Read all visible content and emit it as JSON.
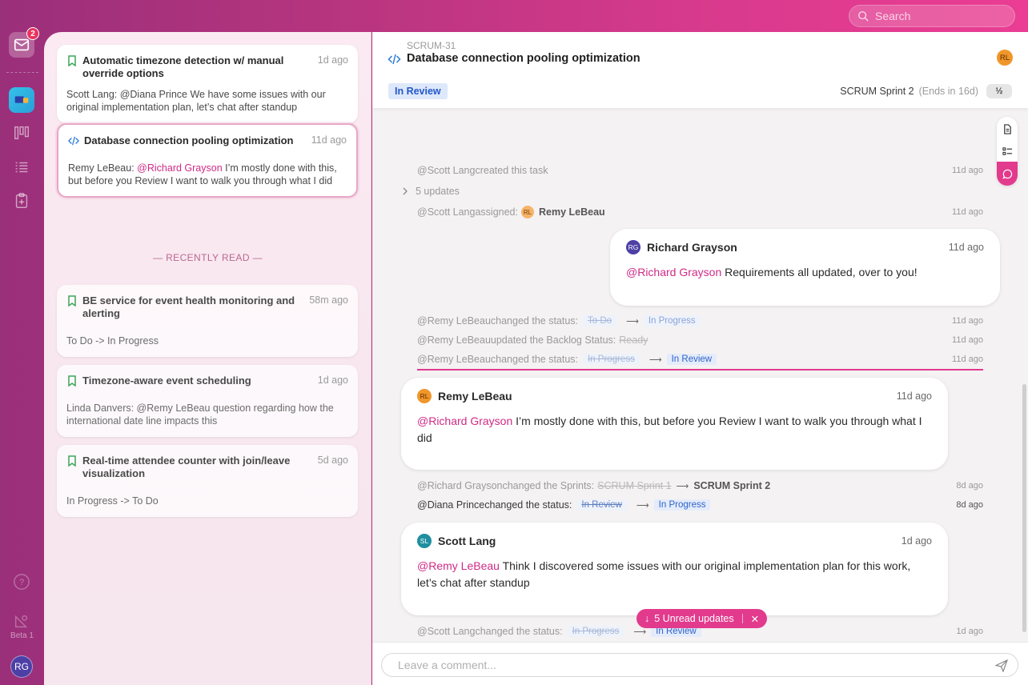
{
  "search": {
    "placeholder": "Search"
  },
  "rail": {
    "inbox_badge": "2",
    "beta_label": "Beta 1",
    "user_initials": "RG"
  },
  "inbox": {
    "unread": [
      {
        "title": "Automatic timezone detection w/ manual override options",
        "time": "1d ago",
        "author": "Scott Lang: ",
        "text": "@Diana Prince We have some issues with our original implementation plan, let’s chat after standup"
      },
      {
        "title": "Database connection pooling optimization",
        "time": "11d ago",
        "author": "Remy LeBeau: ",
        "mention": "@Richard Grayson",
        "text": " I’m mostly done with this, but before you Review I want to walk you through what I did"
      }
    ],
    "recent_label": "— RECENTLY READ —",
    "recent": [
      {
        "title": "BE service for event health monitoring and alerting",
        "time": "58m ago",
        "text": "To Do -> In Progress"
      },
      {
        "title": "Timezone-aware event scheduling",
        "time": "1d ago",
        "text": "Linda Danvers: @Remy LeBeau question regarding how the international date line impacts this"
      },
      {
        "title": "Real-time attendee counter with join/leave visualization",
        "time": "5d ago",
        "text": "In Progress -> To Do"
      }
    ]
  },
  "ticket": {
    "id": "SCRUM-31",
    "title": "Database connection pooling optimization",
    "assignee_initials": "RL",
    "status": "In Review",
    "sprint": "SCRUM Sprint 2",
    "sprint_ends": "(Ends in 16d)",
    "half_label": "½"
  },
  "activity": {
    "created": {
      "who": "@Scott Lang",
      "action": " created this task",
      "time": "11d ago"
    },
    "updates": "5 updates",
    "assigned": {
      "who": "@Scott Lang",
      "action": " assigned:",
      "avatar": "RL",
      "assignee": "Remy LeBeau",
      "time": "11d ago"
    },
    "comment1": {
      "avatar": "RG",
      "name": "Richard Grayson",
      "time": "11d ago",
      "mention": "@Richard Grayson",
      "text": " Requirements all updated, over to you!"
    },
    "status1": {
      "who": "@Remy LeBeau",
      "action": " changed the status:",
      "from": "To Do",
      "to": "In Progress",
      "time": "11d ago"
    },
    "backlog": {
      "who": "@Remy LeBeau",
      "action": " updated the Backlog Status:",
      "value": "Ready",
      "time": "11d ago"
    },
    "status2": {
      "who": "@Remy LeBeau",
      "action": " changed the status:",
      "from": "In Progress",
      "to": "In Review",
      "time": "11d ago"
    },
    "comment2": {
      "avatar": "RL",
      "name": "Remy LeBeau",
      "time": "11d ago",
      "mention": "@Richard Grayson",
      "text": " I’m mostly done with this, but before you Review I want to walk you through what I did"
    },
    "sprints": {
      "who": "@Richard Grayson",
      "action": " changed the Sprints:",
      "from": "SCRUM Sprint 1",
      "to": "SCRUM Sprint 2",
      "time": "8d ago"
    },
    "status3": {
      "who": "@Diana Prince",
      "action": " changed the status:",
      "from": "In Review",
      "to": "In Progress",
      "time": "8d ago"
    },
    "comment3": {
      "avatar": "SL",
      "name": "Scott Lang",
      "time": "1d ago",
      "mention": "@Remy LeBeau",
      "text": " Think I discovered some issues with our original implementation plan for this work, let’s chat after standup"
    },
    "status4": {
      "who": "@Scott Lang",
      "action": " changed the status:",
      "from": "In Progress",
      "to": "In Review",
      "time": "1d ago"
    }
  },
  "unread_pill": {
    "label": "5 Unread updates"
  },
  "composer": {
    "placeholder": "Leave a comment..."
  },
  "colors": {
    "accent": "#e23a8d",
    "status_blue": "#2458c8",
    "mention": "#d02a86"
  }
}
